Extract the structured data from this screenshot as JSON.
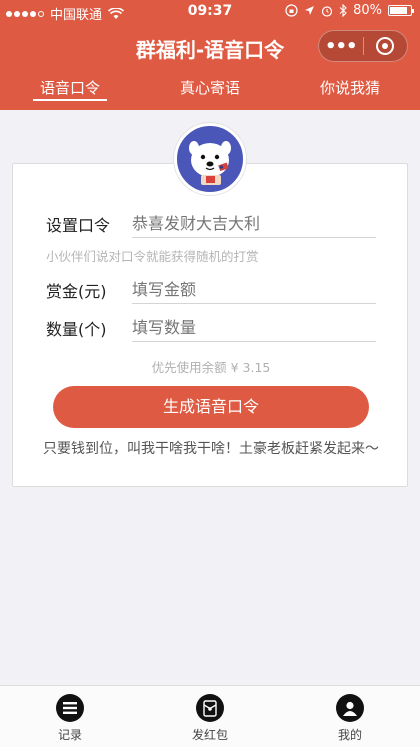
{
  "status_bar": {
    "carrier": "中国联通",
    "time": "09:37",
    "battery": "80%"
  },
  "nav": {
    "title": "群福利-语音口令",
    "more_icon": "ellipsis-icon",
    "close_icon": "target-circle-icon"
  },
  "tabs": [
    {
      "label": "语音口令",
      "active": true
    },
    {
      "label": "真心寄语",
      "active": false
    },
    {
      "label": "你说我猜",
      "active": false
    }
  ],
  "form": {
    "password_label": "设置口令",
    "password_placeholder": "恭喜发财大吉大利",
    "password_hint": "小伙伴们说对口令就能获得随机的打赏",
    "amount_label": "赏金(元)",
    "amount_placeholder": "填写金额",
    "count_label": "数量(个)",
    "count_placeholder": "填写数量",
    "balance_note": "优先使用余额 ¥ 3.15",
    "submit_label": "生成语音口令",
    "slogan": "只要钱到位，叫我干啥我干啥！土豪老板赶紧发起来～"
  },
  "bottom_nav": [
    {
      "label": "记录",
      "icon": "list-icon"
    },
    {
      "label": "发红包",
      "icon": "red-packet-icon"
    },
    {
      "label": "我的",
      "icon": "user-icon"
    }
  ],
  "colors": {
    "brand": "#df5a42",
    "avatar_bg": "#4a56b8"
  }
}
